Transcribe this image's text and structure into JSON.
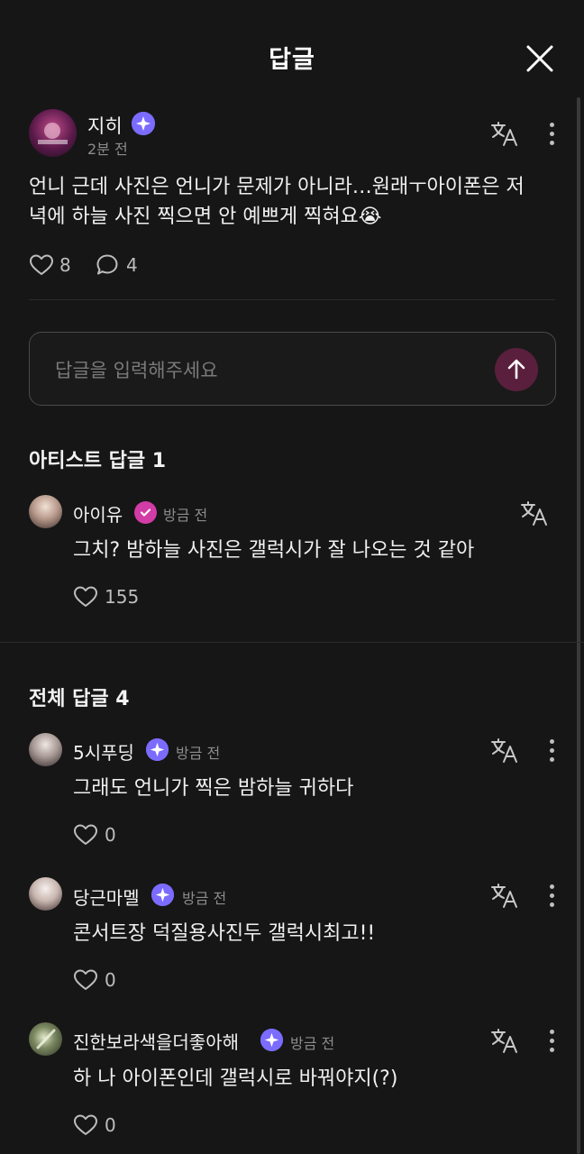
{
  "header": {
    "title": "답글"
  },
  "post": {
    "author": "지히",
    "time": "2분 전",
    "text_line1": "언니 근데 사진은 언니가 문제가 아니라…원래ㅜ아이폰은 저",
    "text_line2": "녁에 하늘 사진 찍으면 안 예쁘게 찍혀요😭",
    "likes": "8",
    "comments": "4"
  },
  "reply_input": {
    "placeholder": "답글을 입력해주세요"
  },
  "artist_section": {
    "title": "아티스트 답글 1",
    "reply": {
      "author": "아이유",
      "time": "방금 전",
      "text": "그치? 밤하늘 사진은 갤럭시가 잘 나오는 것 같아",
      "likes": "155"
    }
  },
  "all_section": {
    "title": "전체 답글 4",
    "replies": [
      {
        "author": "5시푸딩",
        "time": "방금 전",
        "text": "그래도 언니가 찍은 밤하늘 귀하다",
        "likes": "0"
      },
      {
        "author": "당근마멜",
        "time": "방금 전",
        "text": "콘서트장 덕질용사진두 갤럭시최고!!",
        "likes": "0"
      },
      {
        "author": "진한보라색을더좋아해",
        "time": "방금 전",
        "text": "하 나 아이폰인데 갤럭시로 바꿔야지(?)",
        "likes": "0"
      }
    ]
  },
  "icons": {
    "close": "close-icon",
    "translate": "translate-icon",
    "more": "more-vertical-icon",
    "heart": "heart-icon",
    "comment": "comment-icon",
    "send": "arrow-up-icon",
    "verified": "verified-badge-icon",
    "artist_verified": "artist-badge-icon"
  },
  "colors": {
    "background": "#161616",
    "badge": "#7b6cff",
    "artist_badge": "#d23ca6",
    "send_button": "#5a1f3c"
  }
}
